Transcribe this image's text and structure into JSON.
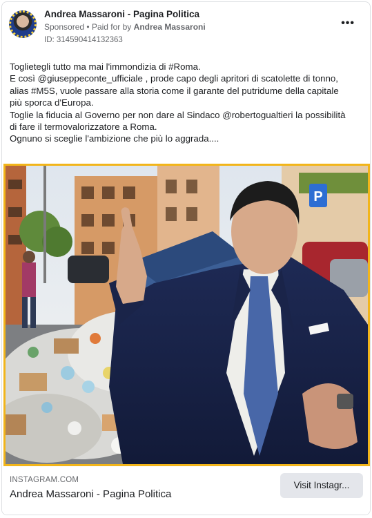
{
  "header": {
    "page_name": "Andrea Massaroni - Pagina Politica",
    "sponsored_label": "Sponsored",
    "separator": "•",
    "paid_for_prefix": "Paid for by",
    "paid_for_name": "Andrea Massaroni",
    "ad_id": "ID: 314590414132363",
    "more_icon_text": "•••"
  },
  "post": {
    "lines": [
      "Toglietegli tutto ma mai l'immondizia di #Roma.",
      "E così @giuseppeconte_ufficiale , prode capo degli apritori di scatolette di tonno,",
      "alias #M5S, vuole passare alla storia come il garante del putridume della capitale",
      "più sporca d'Europa.",
      "Toglie la fiducia al Governo per non dare al Sindaco @robertogualtieri la possibilità",
      "di fare il termovalorizzatore a Roma.",
      "Ognuno si sceglie l'ambizione che più lo aggrada...."
    ]
  },
  "media": {
    "parking_sign": "P",
    "border_color": "#f2b51a"
  },
  "footer": {
    "domain": "INSTAGRAM.COM",
    "title": "Andrea Massaroni - Pagina Politica",
    "cta_label": "Visit Instagr..."
  }
}
